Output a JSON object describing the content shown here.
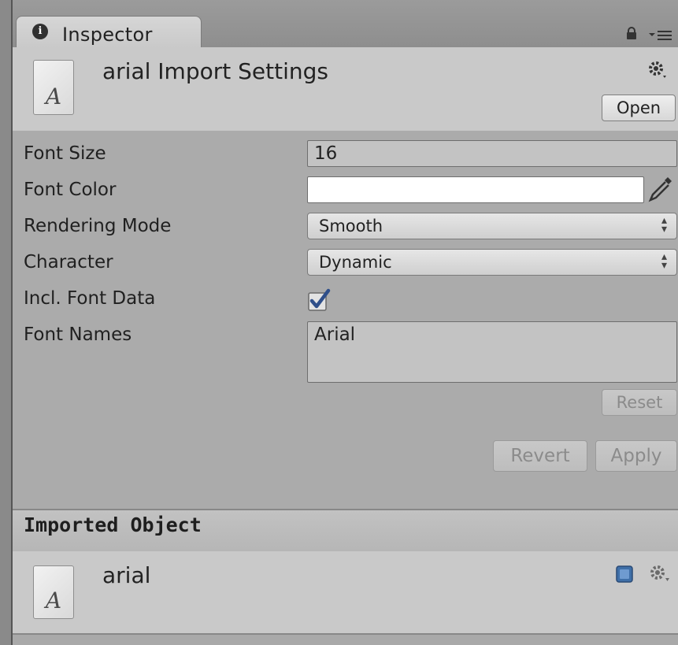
{
  "tab": {
    "icon": "info-icon",
    "icon_glyph": "i",
    "label": "Inspector"
  },
  "toolbar": {
    "lock_icon": "lock-icon",
    "menu_icon": "menu-icon"
  },
  "header": {
    "asset_icon_glyph": "A",
    "title": "arial Import Settings",
    "open_label": "Open"
  },
  "fields": {
    "font_size": {
      "label": "Font Size",
      "value": "16"
    },
    "font_color": {
      "label": "Font Color",
      "value": "#ffffff"
    },
    "rendering_mode": {
      "label": "Rendering Mode",
      "value": "Smooth"
    },
    "character": {
      "label": "Character",
      "value": "Dynamic"
    },
    "incl_font_data": {
      "label": "Incl. Font Data",
      "checked": true
    },
    "font_names": {
      "label": "Font Names",
      "value": "Arial"
    }
  },
  "buttons": {
    "reset": "Reset",
    "revert": "Revert",
    "apply": "Apply"
  },
  "imported": {
    "section_title": "Imported Object",
    "asset_icon_glyph": "A",
    "name": "arial"
  },
  "colors": {
    "checkbox_check": "#2f4f8a",
    "help_icon": "#3f6fa8"
  }
}
